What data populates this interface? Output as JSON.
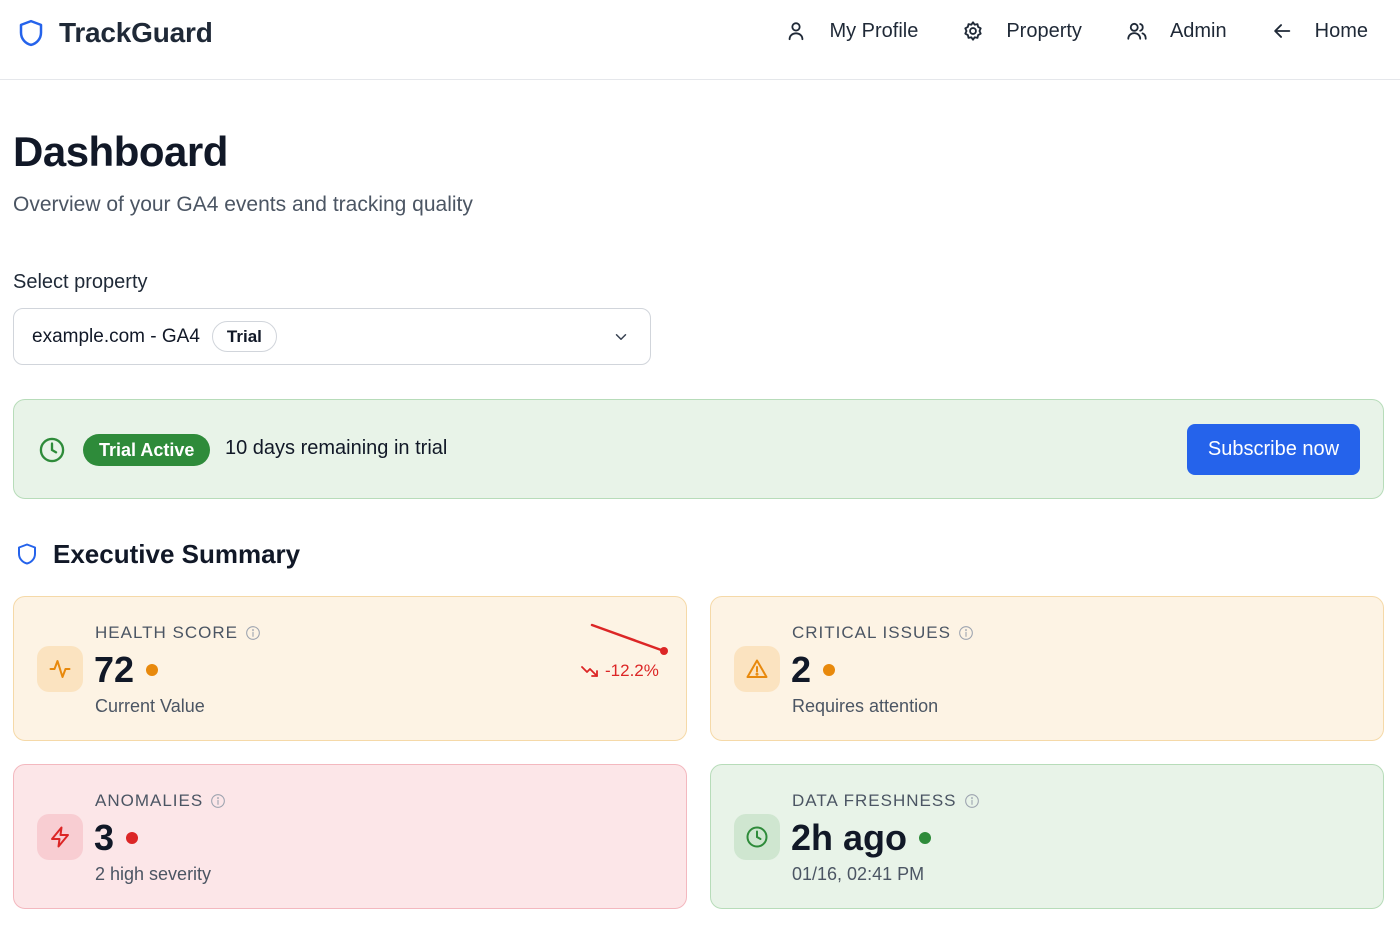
{
  "brand": {
    "name": "TrackGuard",
    "icon": "shield-icon",
    "accent": "#2563eb"
  },
  "nav": {
    "items": [
      {
        "label": "My Profile",
        "icon": "user-icon"
      },
      {
        "label": "Property",
        "icon": "gear-icon"
      },
      {
        "label": "Admin",
        "icon": "users-icon"
      },
      {
        "label": "Home",
        "icon": "arrow-left-icon"
      }
    ]
  },
  "page": {
    "title": "Dashboard",
    "subtitle": "Overview of your GA4 events and tracking quality"
  },
  "property_select": {
    "label": "Select property",
    "value": "example.com - GA4",
    "badge": "Trial"
  },
  "trial": {
    "badge": "Trial Active",
    "message": "10 days remaining in trial",
    "cta": "Subscribe now",
    "color": "#2e8b3a"
  },
  "summary": {
    "title": "Executive Summary",
    "cards": [
      {
        "label": "HEALTH SCORE",
        "value": "72",
        "sub": "Current Value",
        "status": "warning",
        "status_color": "#e8890c",
        "icon": "activity-icon",
        "trend": "-12.2%",
        "trend_direction": "down",
        "trend_color": "#dc2626"
      },
      {
        "label": "CRITICAL ISSUES",
        "value": "2",
        "sub": "Requires attention",
        "status": "warning",
        "status_color": "#e8890c",
        "icon": "alert-triangle-icon"
      },
      {
        "label": "ANOMALIES",
        "value": "3",
        "sub": "2 high severity",
        "status": "error",
        "status_color": "#dc2626",
        "icon": "zap-icon"
      },
      {
        "label": "DATA FRESHNESS",
        "value": "2h ago",
        "sub": "01/16, 02:41 PM",
        "status": "ok",
        "status_color": "#2e8b3a",
        "icon": "clock-icon"
      }
    ]
  }
}
